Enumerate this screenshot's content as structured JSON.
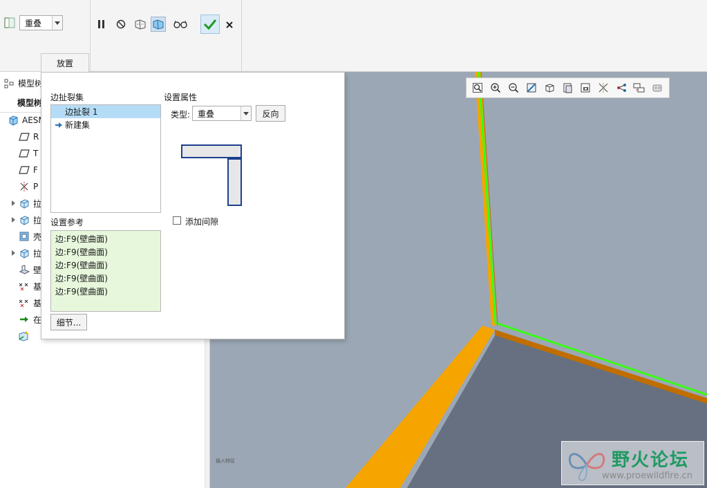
{
  "ribbon": {
    "type_value": "重叠",
    "tab_placement": "放置",
    "tools": [
      {
        "name": "pause-icon"
      },
      {
        "name": "no-preview-icon"
      },
      {
        "name": "geometry-preview-icon"
      },
      {
        "name": "feature-preview-icon"
      },
      {
        "name": "verify-glasses-icon"
      }
    ]
  },
  "model_tree": {
    "header": "模型树",
    "subheader": "模型树",
    "items": [
      {
        "label": "AESM",
        "icon": "part-icon",
        "expander": false,
        "indent": 0
      },
      {
        "label": "R",
        "icon": "datum-plane-icon",
        "expander": false,
        "indent": 1
      },
      {
        "label": "T",
        "icon": "datum-plane-icon",
        "expander": false,
        "indent": 1
      },
      {
        "label": "F",
        "icon": "datum-plane-icon",
        "expander": false,
        "indent": 1
      },
      {
        "label": "P",
        "icon": "coordinate-system-icon",
        "expander": false,
        "indent": 1
      },
      {
        "label": "拉",
        "icon": "extrude-icon",
        "expander": true,
        "indent": 1
      },
      {
        "label": "拉",
        "icon": "extrude-icon",
        "expander": true,
        "indent": 1
      },
      {
        "label": "壳",
        "icon": "shell-icon",
        "expander": false,
        "indent": 1
      },
      {
        "label": "拉",
        "icon": "extrude-icon",
        "expander": true,
        "indent": 1
      },
      {
        "label": "壁",
        "icon": "wall-icon",
        "expander": false,
        "indent": 1
      },
      {
        "label": "基",
        "icon": "datum-point-icon",
        "expander": false,
        "indent": 1
      },
      {
        "label": "基",
        "icon": "datum-point-icon",
        "expander": false,
        "indent": 1
      },
      {
        "label": "在",
        "icon": "insert-here-icon",
        "expander": false,
        "indent": 1
      },
      {
        "label": "",
        "icon": "edge-rip-feature-icon",
        "expander": false,
        "indent": 1
      }
    ]
  },
  "popup": {
    "rip_sets_label": "边扯裂集",
    "rip_sets": [
      {
        "label": "边扯裂 1",
        "selected": true,
        "icon": ""
      },
      {
        "label": "新建集",
        "selected": false,
        "icon": "new-set-arrow-icon"
      }
    ],
    "refs_label": "设置参考",
    "references": [
      "边:F9(壁曲面)",
      "边:F9(壁曲面)",
      "边:F9(壁曲面)",
      "边:F9(壁曲面)",
      "边:F9(壁曲面)"
    ],
    "details_button": "细节...",
    "props_label": "设置属性",
    "type_label": "类型:",
    "type_value": "重叠",
    "flip_button": "反向",
    "add_gap_label": "添加间隙",
    "add_gap_checked": false
  },
  "viewport": {
    "tools": [
      "refit-icon",
      "zoom-in-icon",
      "zoom-out-icon",
      "repaint-icon",
      "display-style-icon",
      "saved-views-icon",
      "view-manager-icon",
      "datum-display-icon",
      "annotation-icon",
      "spin-center-icon",
      "appearance-icon"
    ],
    "note": "插入特征",
    "watermark_title": "野火论坛",
    "watermark_url": "www.proewildfire.cn",
    "colors": {
      "background": "#9ba7b5",
      "face_dark": "#667080",
      "edge_orange": "#f5a400",
      "edge_green": "#39ff12"
    }
  }
}
